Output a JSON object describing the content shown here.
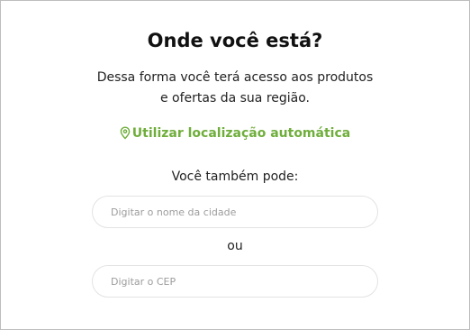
{
  "location_modal": {
    "title": "Onde você está?",
    "subtitle_line1": "Dessa forma você terá acesso aos produtos",
    "subtitle_line2": "e ofertas da sua região.",
    "auto_location": {
      "label": "Utilizar localização automática",
      "icon": "location-pin-icon",
      "color": "#6fae3b"
    },
    "alternative_label": "Você também pode:",
    "city_input": {
      "value": "",
      "placeholder": "Digitar o nome da cidade"
    },
    "separator": "ou",
    "cep_input": {
      "value": "",
      "placeholder": "Digitar o CEP"
    }
  }
}
